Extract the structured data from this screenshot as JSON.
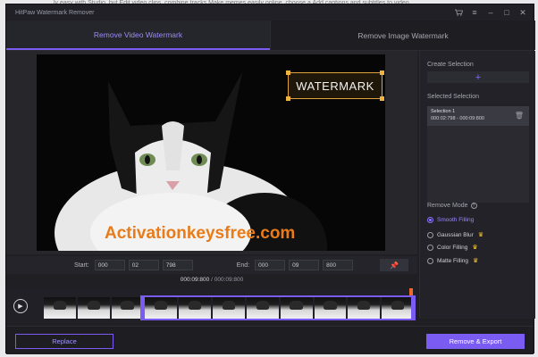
{
  "window": {
    "title": "HitPaw Watermark Remover",
    "controls": [
      "cart-icon",
      "menu-icon",
      "minimize-icon",
      "maximize-icon",
      "close-icon"
    ],
    "accent": "#7a5cf2"
  },
  "background": {
    "text": "ly easy with Studio, but    Edit video clips, combine tracks    Make memes easily online, choose a    Add captions and subtitles to video"
  },
  "tabs": [
    {
      "label": "Remove Video Watermark",
      "active": true
    },
    {
      "label": "Remove Image Watermark",
      "active": false
    }
  ],
  "preview": {
    "watermark_text": "WATERMARK",
    "overlay_text": "Activationkeysfree.com"
  },
  "time": {
    "start_label": "Start:",
    "end_label": "End:",
    "start": [
      "000",
      "02",
      "798"
    ],
    "end": [
      "000",
      "09",
      "800"
    ],
    "current": "000:09:800",
    "separator": "/",
    "total": "000:09:800"
  },
  "side": {
    "create_heading": "Create Selection",
    "create_symbol": "+",
    "selected_heading": "Selected Selection",
    "selection": {
      "name": "Selection 1",
      "range": "000:02:798 - 000:09:800"
    },
    "remove_mode_heading": "Remove Mode",
    "modes": [
      {
        "label": "Smooth Filling",
        "selected": true,
        "premium": false
      },
      {
        "label": "Gaussian Blur",
        "selected": false,
        "premium": true
      },
      {
        "label": "Color Filling",
        "selected": false,
        "premium": true
      },
      {
        "label": "Matte Filling",
        "selected": false,
        "premium": true
      }
    ]
  },
  "buttons": {
    "replace": "Replace",
    "export": "Remove & Export"
  }
}
